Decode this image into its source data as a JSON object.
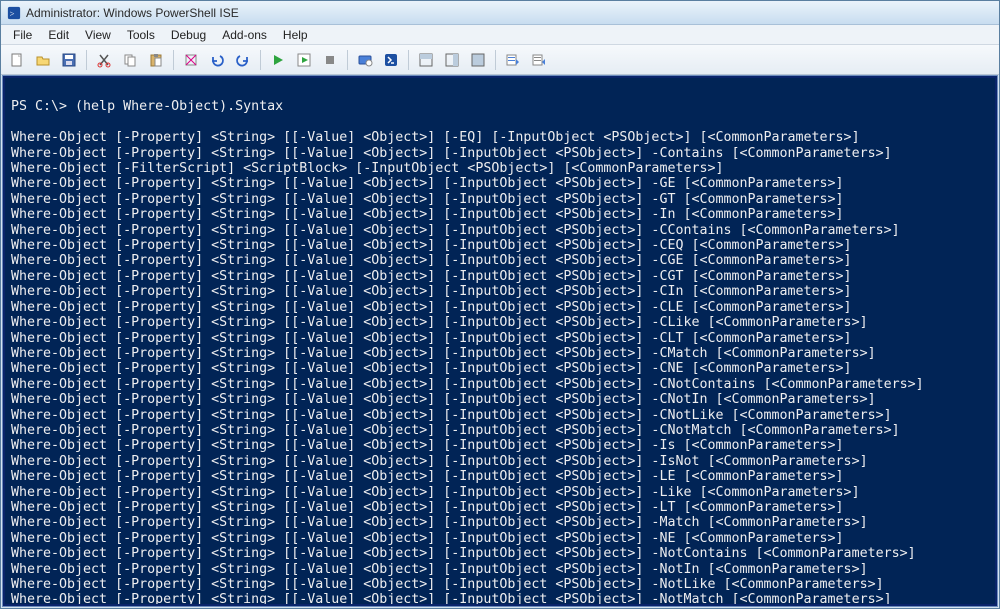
{
  "window": {
    "title": "Administrator: Windows PowerShell ISE"
  },
  "menu": {
    "items": [
      "File",
      "Edit",
      "View",
      "Tools",
      "Debug",
      "Add-ons",
      "Help"
    ]
  },
  "toolbar": {
    "buttons": [
      {
        "name": "new-icon",
        "title": "New"
      },
      {
        "name": "open-icon",
        "title": "Open"
      },
      {
        "name": "save-icon",
        "title": "Save"
      },
      {
        "sep": true
      },
      {
        "name": "cut-icon",
        "title": "Cut"
      },
      {
        "name": "copy-icon",
        "title": "Copy"
      },
      {
        "name": "paste-icon",
        "title": "Paste"
      },
      {
        "sep": true
      },
      {
        "name": "clear-icon",
        "title": "Clear"
      },
      {
        "name": "undo-icon",
        "title": "Undo"
      },
      {
        "name": "redo-icon",
        "title": "Redo"
      },
      {
        "sep": true
      },
      {
        "name": "run-icon",
        "title": "Run"
      },
      {
        "name": "run-selection-icon",
        "title": "Run Selection"
      },
      {
        "name": "stop-icon",
        "title": "Stop"
      },
      {
        "sep": true
      },
      {
        "name": "remote-icon",
        "title": "New Remote Tab"
      },
      {
        "name": "powershell-icon",
        "title": "Start PowerShell"
      },
      {
        "sep": true
      },
      {
        "name": "script-top-icon",
        "title": "Show Script Pane Top"
      },
      {
        "name": "script-right-icon",
        "title": "Show Script Pane Right"
      },
      {
        "name": "script-max-icon",
        "title": "Show Script Pane Max"
      },
      {
        "sep": true
      },
      {
        "name": "commands-icon",
        "title": "Show Command"
      },
      {
        "name": "addon-icon",
        "title": "Show Addon"
      }
    ]
  },
  "console": {
    "prompt": "PS C:\\> ",
    "command": "(help Where-Object).Syntax",
    "lines": [
      "Where-Object [-Property] <String> [[-Value] <Object>] [-EQ] [-InputObject <PSObject>] [<CommonParameters>]",
      "Where-Object [-Property] <String> [[-Value] <Object>] [-InputObject <PSObject>] -Contains [<CommonParameters>]",
      "Where-Object [-FilterScript] <ScriptBlock> [-InputObject <PSObject>] [<CommonParameters>]",
      "Where-Object [-Property] <String> [[-Value] <Object>] [-InputObject <PSObject>] -GE [<CommonParameters>]",
      "Where-Object [-Property] <String> [[-Value] <Object>] [-InputObject <PSObject>] -GT [<CommonParameters>]",
      "Where-Object [-Property] <String> [[-Value] <Object>] [-InputObject <PSObject>] -In [<CommonParameters>]",
      "Where-Object [-Property] <String> [[-Value] <Object>] [-InputObject <PSObject>] -CContains [<CommonParameters>]",
      "Where-Object [-Property] <String> [[-Value] <Object>] [-InputObject <PSObject>] -CEQ [<CommonParameters>]",
      "Where-Object [-Property] <String> [[-Value] <Object>] [-InputObject <PSObject>] -CGE [<CommonParameters>]",
      "Where-Object [-Property] <String> [[-Value] <Object>] [-InputObject <PSObject>] -CGT [<CommonParameters>]",
      "Where-Object [-Property] <String> [[-Value] <Object>] [-InputObject <PSObject>] -CIn [<CommonParameters>]",
      "Where-Object [-Property] <String> [[-Value] <Object>] [-InputObject <PSObject>] -CLE [<CommonParameters>]",
      "Where-Object [-Property] <String> [[-Value] <Object>] [-InputObject <PSObject>] -CLike [<CommonParameters>]",
      "Where-Object [-Property] <String> [[-Value] <Object>] [-InputObject <PSObject>] -CLT [<CommonParameters>]",
      "Where-Object [-Property] <String> [[-Value] <Object>] [-InputObject <PSObject>] -CMatch [<CommonParameters>]",
      "Where-Object [-Property] <String> [[-Value] <Object>] [-InputObject <PSObject>] -CNE [<CommonParameters>]",
      "Where-Object [-Property] <String> [[-Value] <Object>] [-InputObject <PSObject>] -CNotContains [<CommonParameters>]",
      "Where-Object [-Property] <String> [[-Value] <Object>] [-InputObject <PSObject>] -CNotIn [<CommonParameters>]",
      "Where-Object [-Property] <String> [[-Value] <Object>] [-InputObject <PSObject>] -CNotLike [<CommonParameters>]",
      "Where-Object [-Property] <String> [[-Value] <Object>] [-InputObject <PSObject>] -CNotMatch [<CommonParameters>]",
      "Where-Object [-Property] <String> [[-Value] <Object>] [-InputObject <PSObject>] -Is [<CommonParameters>]",
      "Where-Object [-Property] <String> [[-Value] <Object>] [-InputObject <PSObject>] -IsNot [<CommonParameters>]",
      "Where-Object [-Property] <String> [[-Value] <Object>] [-InputObject <PSObject>] -LE [<CommonParameters>]",
      "Where-Object [-Property] <String> [[-Value] <Object>] [-InputObject <PSObject>] -Like [<CommonParameters>]",
      "Where-Object [-Property] <String> [[-Value] <Object>] [-InputObject <PSObject>] -LT [<CommonParameters>]",
      "Where-Object [-Property] <String> [[-Value] <Object>] [-InputObject <PSObject>] -Match [<CommonParameters>]",
      "Where-Object [-Property] <String> [[-Value] <Object>] [-InputObject <PSObject>] -NE [<CommonParameters>]",
      "Where-Object [-Property] <String> [[-Value] <Object>] [-InputObject <PSObject>] -NotContains [<CommonParameters>]",
      "Where-Object [-Property] <String> [[-Value] <Object>] [-InputObject <PSObject>] -NotIn [<CommonParameters>]",
      "Where-Object [-Property] <String> [[-Value] <Object>] [-InputObject <PSObject>] -NotLike [<CommonParameters>]",
      "Where-Object [-Property] <String> [[-Value] <Object>] [-InputObject <PSObject>] -NotMatch [<CommonParameters>]"
    ]
  }
}
